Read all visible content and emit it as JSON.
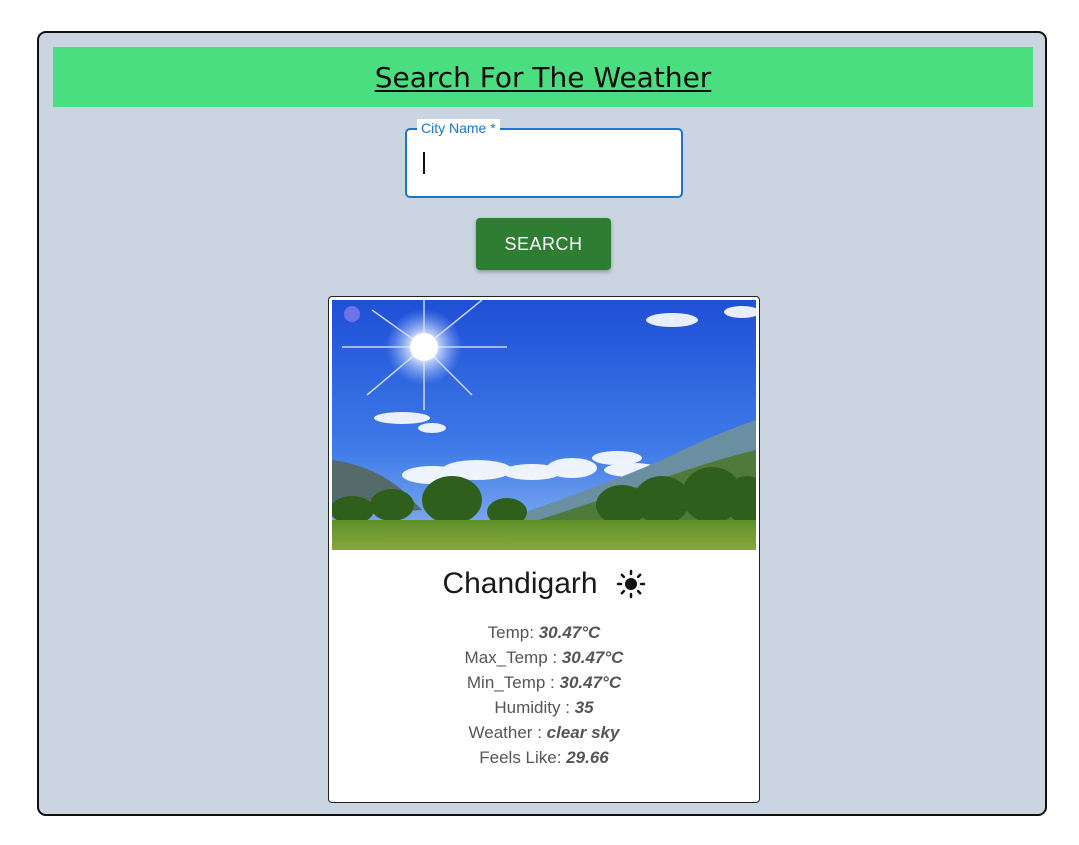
{
  "header": {
    "title": "Search For The Weather"
  },
  "search": {
    "label": "City Name *",
    "value": "",
    "button_label": "SEARCH"
  },
  "card": {
    "city": "Chandigarh",
    "weather_icon": "sun-icon",
    "stats": [
      {
        "label": "Temp: ",
        "value": "30.47°C"
      },
      {
        "label": "Max_Temp : ",
        "value": "30.47°C"
      },
      {
        "label": "Min_Temp : ",
        "value": "30.47°C"
      },
      {
        "label": "Humidity : ",
        "value": "35"
      },
      {
        "label": "Weather : ",
        "value": "clear sky"
      },
      {
        "label": "Feels Like: ",
        "value": "29.66"
      }
    ]
  },
  "colors": {
    "background": "#cbd5e1",
    "header": "#4ade80",
    "button": "#2e7d32",
    "input_accent": "#1976d2"
  }
}
